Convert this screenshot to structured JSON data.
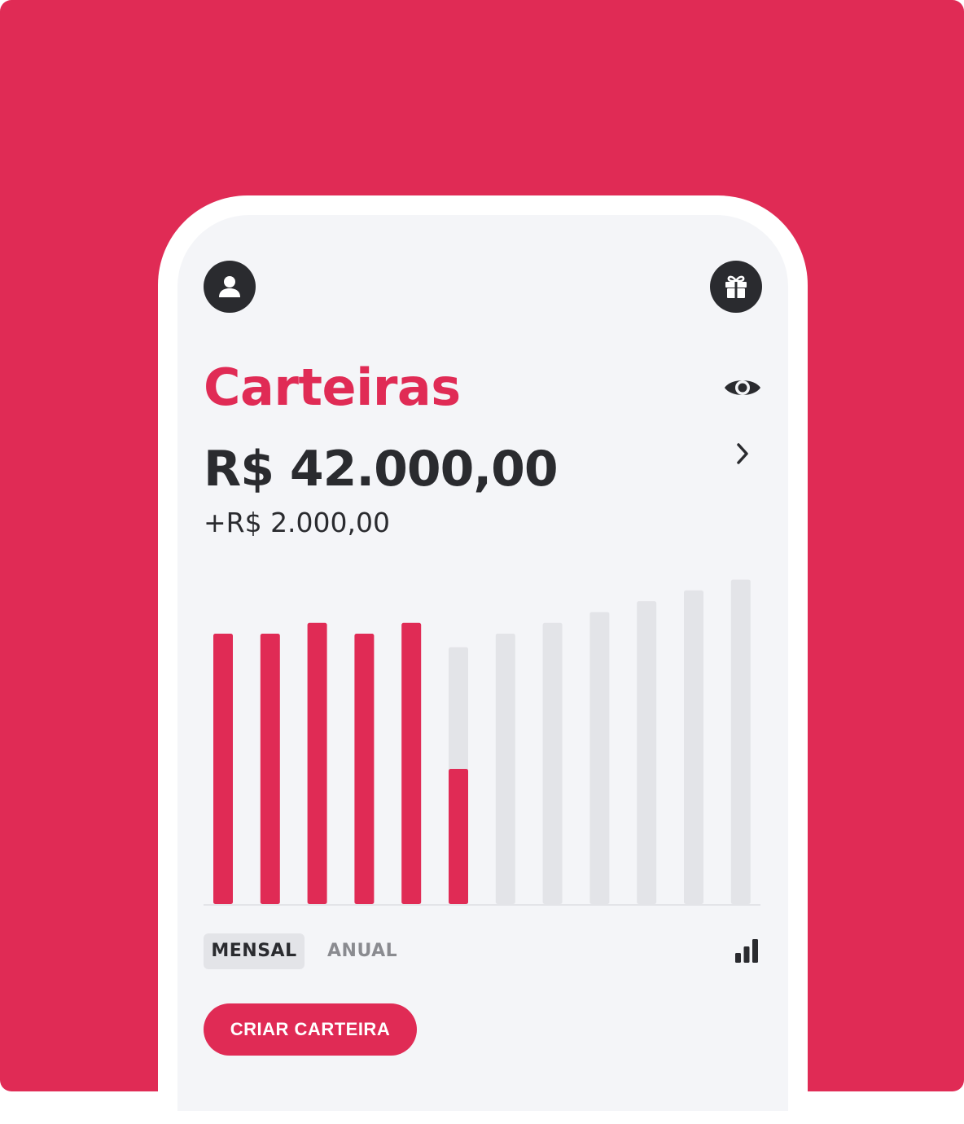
{
  "header": {
    "profile_icon": "user-icon",
    "gift_icon": "gift-icon"
  },
  "wallet": {
    "title": "Carteiras",
    "balance": "R$ 42.000,00",
    "change": "+R$ 2.000,00",
    "visibility_icon": "eye-icon",
    "details_icon": "chevron-right-icon"
  },
  "chart_data": {
    "type": "bar",
    "categories": [
      "",
      "",
      "",
      "",
      "",
      "",
      "",
      "",
      "",
      "",
      "",
      ""
    ],
    "values": [
      100,
      100,
      104,
      100,
      104,
      50,
      100,
      104,
      108,
      112,
      116,
      120
    ],
    "totals": [
      100,
      100,
      104,
      100,
      104,
      95,
      100,
      104,
      108,
      112,
      116,
      120
    ],
    "accent_color": "#E02B55",
    "track_color": "#E3E4E8",
    "grid": false,
    "axes_visible": false
  },
  "period_tabs": {
    "active": "MENSAL",
    "inactive": "ANUAL",
    "chart_icon": "bar-chart-icon"
  },
  "cta": {
    "label": "CRIAR CARTEIRA"
  },
  "colors": {
    "brand": "#E02B55",
    "dark": "#2A2B2F",
    "screen": "#F4F5F8"
  }
}
